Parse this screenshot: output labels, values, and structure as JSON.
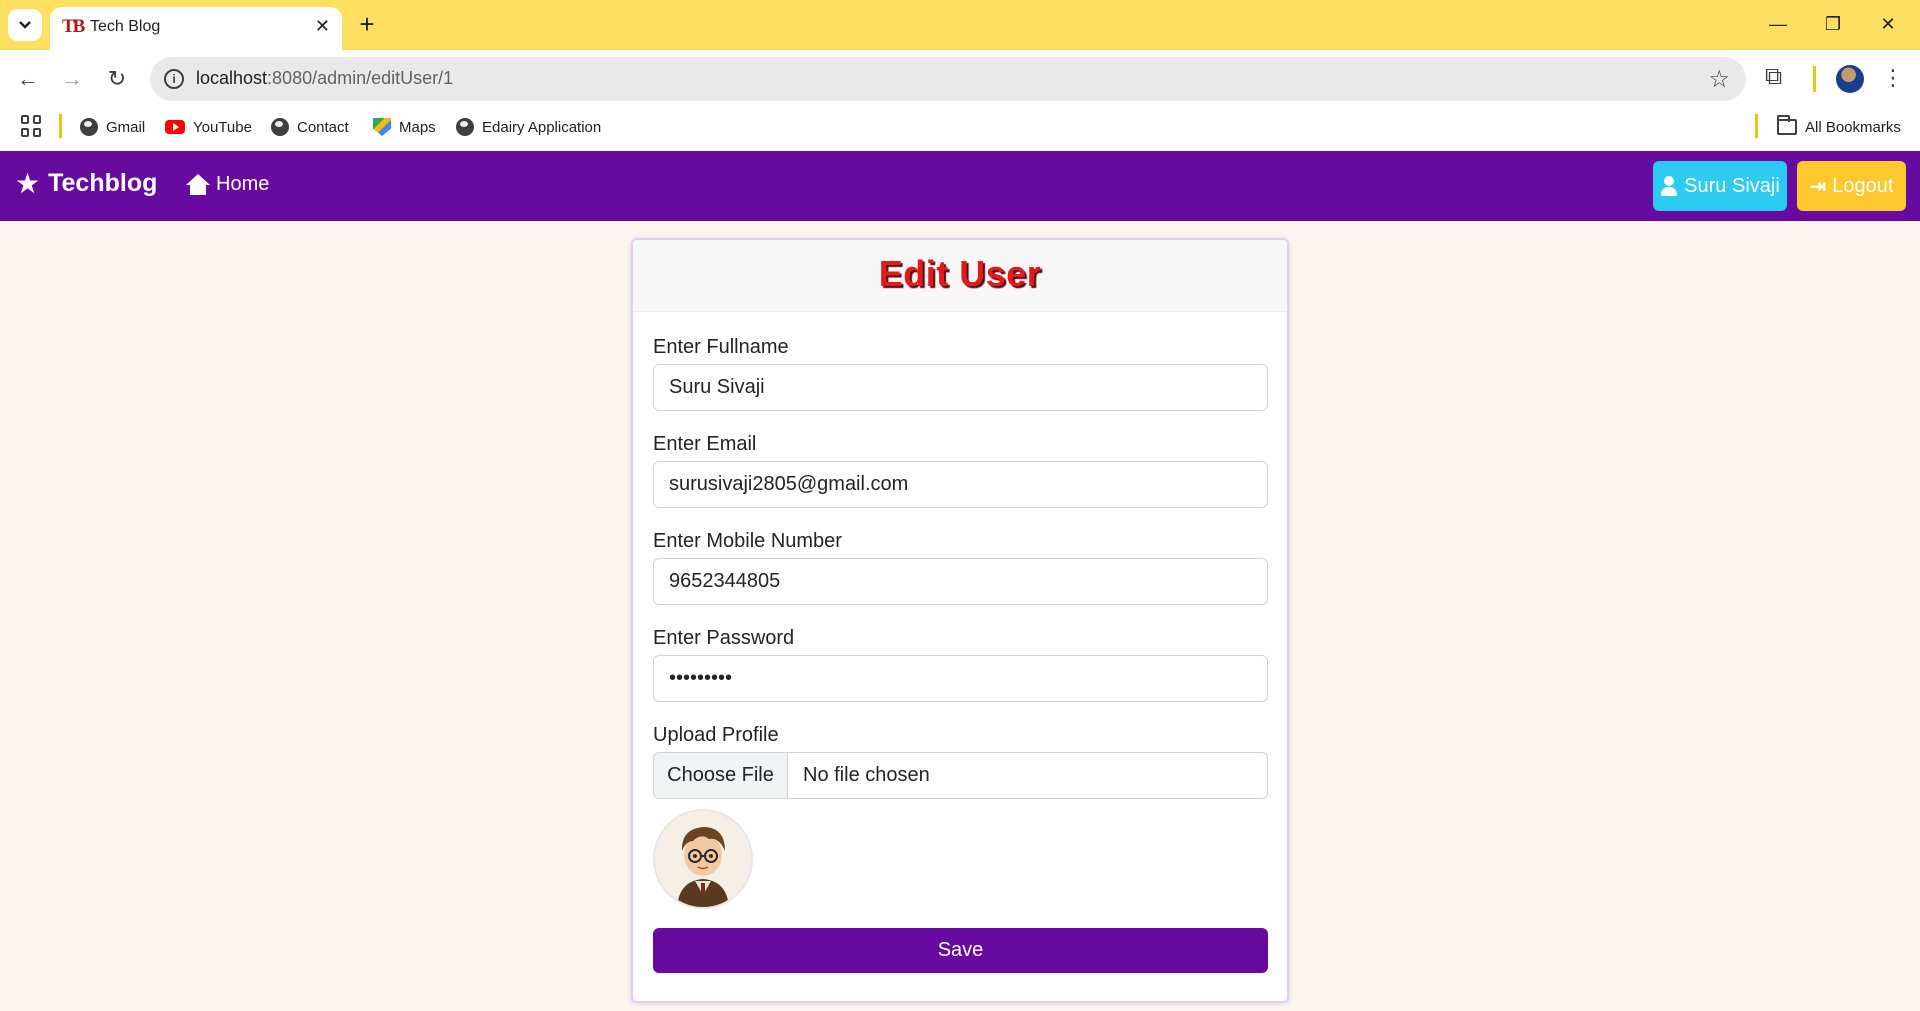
{
  "browser": {
    "tab_title": "Tech Blog",
    "tab_favicon": "TB",
    "url_host": "localhost",
    "url_rest": ":8080/admin/editUser/1",
    "bookmarks": [
      "Gmail",
      "YouTube",
      "Contact",
      "Maps",
      "Edairy Application"
    ],
    "all_bookmarks": "All Bookmarks"
  },
  "navbar": {
    "brand": "Techblog",
    "home": "Home",
    "user_button": "Suru Sivaji",
    "logout_button": "Logout",
    "color": "#660aa0"
  },
  "form": {
    "title": "Edit User",
    "fullname_label": "Enter Fullname",
    "fullname_value": "Suru Sivaji",
    "email_label": "Enter Email",
    "email_value": "surusivaji2805@gmail.com",
    "mobile_label": "Enter Mobile Number",
    "mobile_value": "9652344805",
    "password_label": "Enter Password",
    "password_value": "•••••••••",
    "upload_label": "Upload Profile",
    "choose_file": "Choose File",
    "no_file": "No file chosen",
    "save_button": "Save"
  }
}
